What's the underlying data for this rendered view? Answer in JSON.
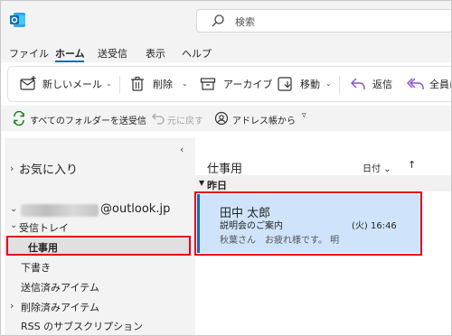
{
  "search": {
    "placeholder": "検索"
  },
  "menu": {
    "items": [
      "ファイル",
      "ホーム",
      "送受信",
      "表示",
      "ヘルプ"
    ],
    "active": "ホーム"
  },
  "ribbon": {
    "new_mail": "新しいメール",
    "delete": "削除",
    "archive": "アーカイブ",
    "move": "移動",
    "reply": "返信",
    "reply_all": "全員に"
  },
  "quickbar": {
    "send_receive_all": "すべてのフォルダーを送受信",
    "undo": "元に戻す",
    "address_book": "アドレス帳から"
  },
  "nav": {
    "favorites": "お気に入り",
    "account_suffix": "@outlook.jp",
    "folders": {
      "inbox": "受信トレイ",
      "work": "仕事用",
      "drafts": "下書き",
      "sent": "送信済みアイテム",
      "deleted": "削除済みアイテム",
      "rss": "RSS のサブスクリプション"
    }
  },
  "list": {
    "title": "仕事用",
    "sort_label": "日付",
    "group_label": "昨日",
    "message": {
      "sender": "田中 太郎",
      "subject": "説明会のご案内",
      "time": "(火) 16:46",
      "preview": "秋葉さん　お疲れ様です。 明"
    }
  },
  "colors": {
    "accent": "#0f6cbd",
    "highlight": "#e8001c",
    "selected_mail": "#cfe4fa"
  }
}
